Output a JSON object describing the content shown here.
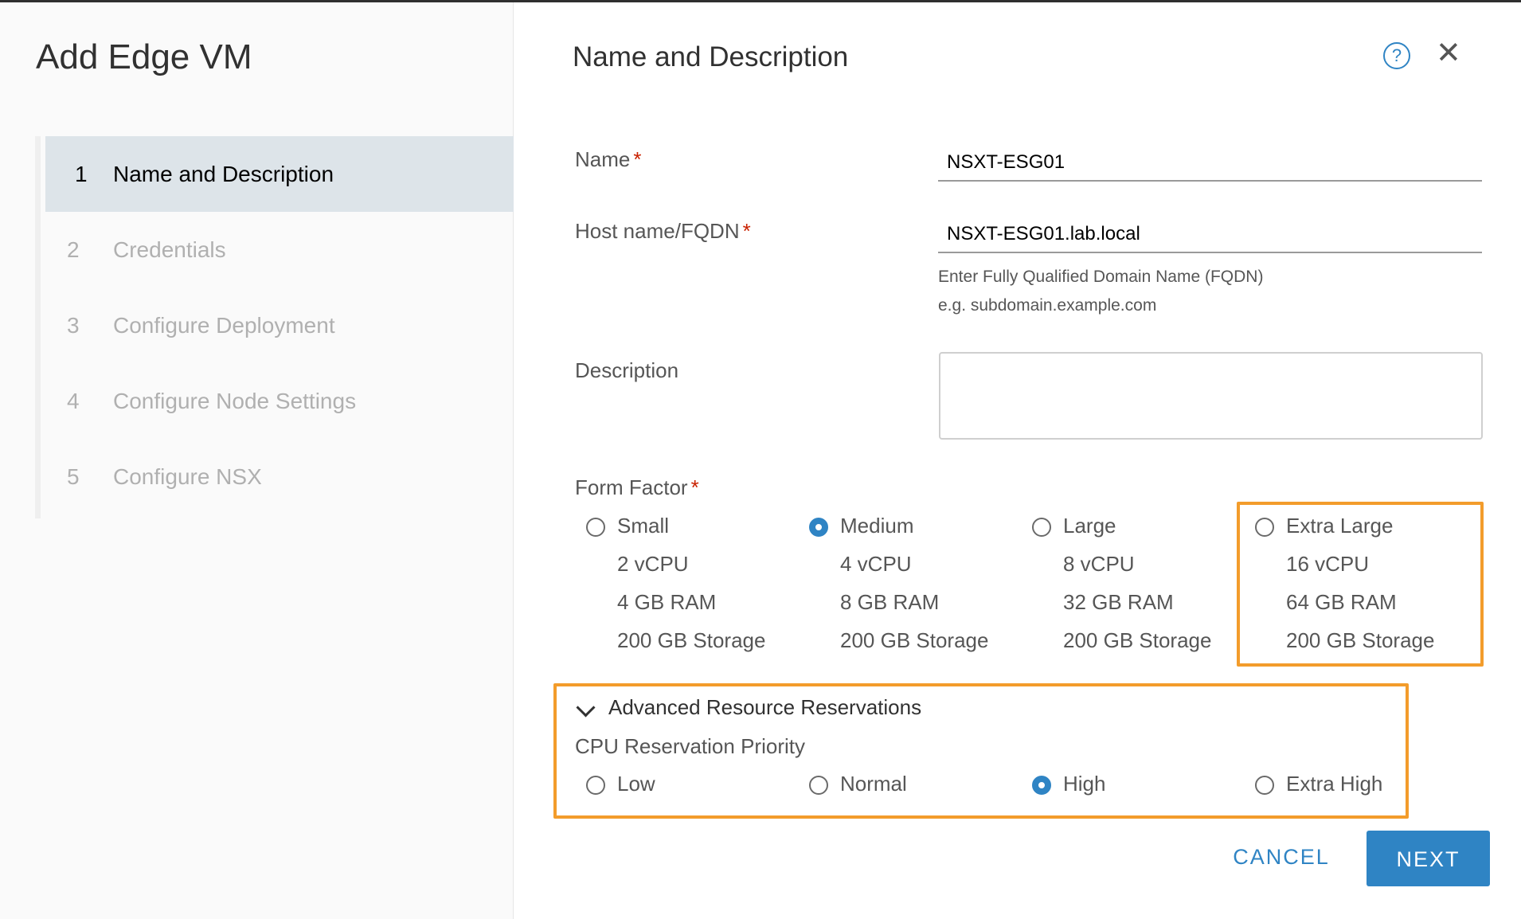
{
  "wizard": {
    "title": "Add Edge VM",
    "steps": [
      {
        "num": "1",
        "label": "Name and Description"
      },
      {
        "num": "2",
        "label": "Credentials"
      },
      {
        "num": "3",
        "label": "Configure Deployment"
      },
      {
        "num": "4",
        "label": "Configure Node Settings"
      },
      {
        "num": "5",
        "label": "Configure NSX"
      }
    ]
  },
  "page": {
    "title": "Name and Description",
    "help_icon": "?",
    "close_icon": "✕"
  },
  "form": {
    "name_label": "Name",
    "name_value": "NSXT-ESG01",
    "host_label": "Host name/FQDN",
    "host_value": "NSXT-ESG01.lab.local",
    "host_help_1": "Enter Fully Qualified Domain Name (FQDN)",
    "host_help_2": "e.g. subdomain.example.com",
    "description_label": "Description",
    "description_value": "",
    "required_mark": "*",
    "form_factor_label": "Form Factor",
    "form_factor_options": [
      {
        "label": "Small",
        "cpu": "2 vCPU",
        "ram": "4 GB RAM",
        "storage": "200 GB Storage",
        "checked": false
      },
      {
        "label": "Medium",
        "cpu": "4 vCPU",
        "ram": "8 GB RAM",
        "storage": "200 GB Storage",
        "checked": true
      },
      {
        "label": "Large",
        "cpu": "8 vCPU",
        "ram": "32 GB RAM",
        "storage": "200 GB Storage",
        "checked": false
      },
      {
        "label": "Extra Large",
        "cpu": "16 vCPU",
        "ram": "64 GB RAM",
        "storage": "200 GB Storage",
        "checked": false
      }
    ],
    "advanced_label": "Advanced Resource Reservations",
    "cpu_priority_label": "CPU Reservation Priority",
    "cpu_priority_options": [
      {
        "label": "Low",
        "checked": false
      },
      {
        "label": "Normal",
        "checked": false
      },
      {
        "label": "High",
        "checked": true
      },
      {
        "label": "Extra High",
        "checked": false
      }
    ]
  },
  "buttons": {
    "cancel": "CANCEL",
    "next": "NEXT"
  },
  "colors": {
    "accent": "#2f84c4",
    "highlight": "#f39c2b",
    "required": "#c92100"
  }
}
